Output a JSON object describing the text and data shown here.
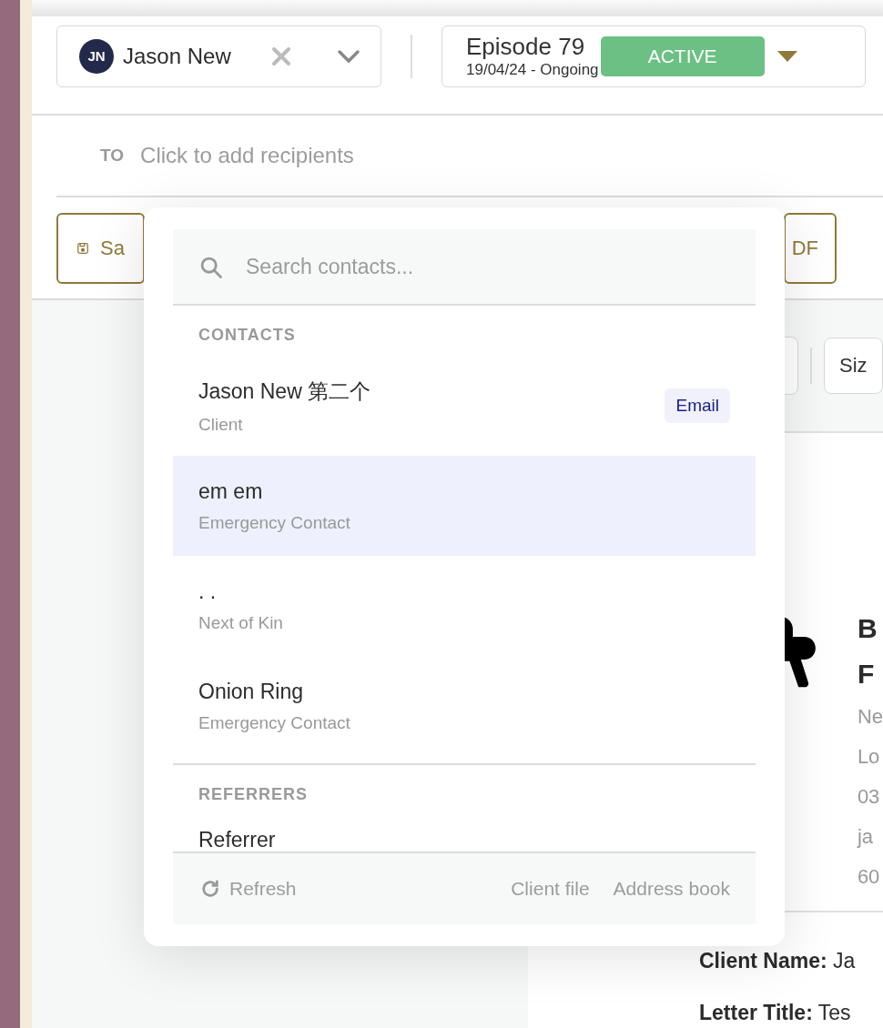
{
  "patient": {
    "initials": "JN",
    "name": "Jason New"
  },
  "episode": {
    "title": "Episode 79",
    "subtitle": "19/04/24 - Ongoing",
    "status": "ACTIVE"
  },
  "recipients": {
    "label": "TO",
    "placeholder": "Click to add recipients"
  },
  "toolbar": {
    "buttons": [
      {
        "label": "Sa"
      },
      {
        "label": "DF"
      }
    ]
  },
  "preview": {
    "size_select": "Siz",
    "letterhead": {
      "title_lines": [
        "B",
        "F"
      ],
      "details": [
        "Ne",
        "Lo",
        "03",
        "ja",
        "60"
      ]
    },
    "fields": [
      "**Client Name:** Ja",
      "**Letter Title:** Tes"
    ]
  },
  "contact_picker": {
    "search": {
      "placeholder": "Search contacts..."
    },
    "sections": [
      {
        "title": "CONTACTS",
        "items": [
          {
            "name": "Jason New 第二个",
            "role": "Client",
            "badge": "Email",
            "selected": false
          },
          {
            "name": "em em",
            "role": "Emergency Contact",
            "selected": true
          },
          {
            "name": ". .",
            "role": "Next of Kin",
            "selected": false
          },
          {
            "name": "Onion Ring",
            "role": "Emergency Contact",
            "selected": false
          }
        ]
      },
      {
        "title": "REFERRERS",
        "items": [
          {
            "name": "Referrer",
            "selected": false
          }
        ]
      }
    ],
    "footer": {
      "refresh": "Refresh",
      "links": [
        "Client file",
        "Address book"
      ]
    }
  }
}
